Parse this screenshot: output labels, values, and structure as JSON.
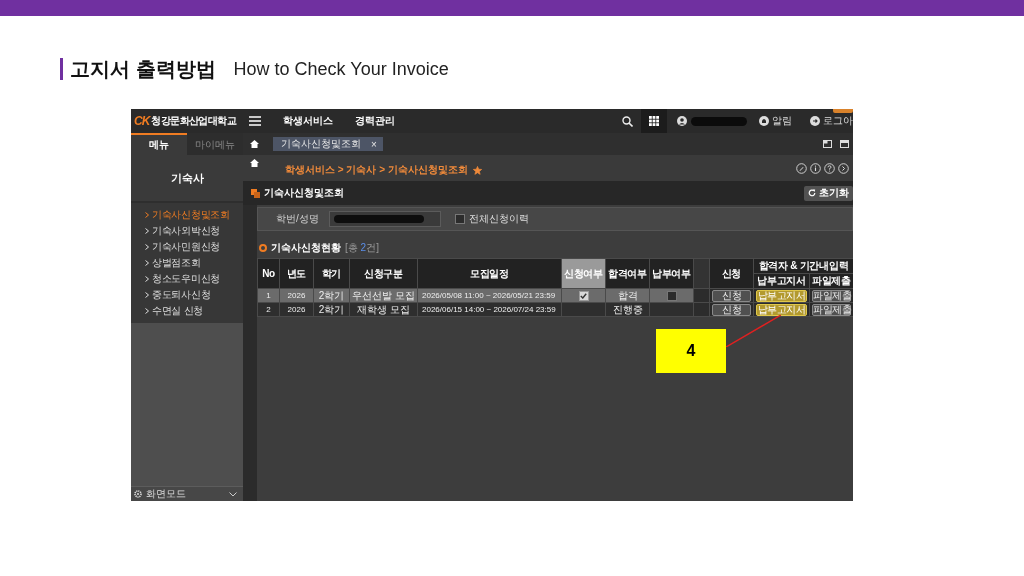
{
  "slide": {
    "title": "고지서 출력방법",
    "subtitle": "How to Check Your Invoice"
  },
  "header": {
    "logo_mark": "CK",
    "school_name": "청강문화산업대학교",
    "nav": [
      "학생서비스",
      "경력관리"
    ],
    "notification": "알림",
    "logout": "로그아"
  },
  "sidebar": {
    "tabs": [
      {
        "label": "메뉴",
        "selected": true
      },
      {
        "label": "마이메뉴",
        "selected": false
      }
    ],
    "title": "기숙사",
    "items": [
      {
        "label": "기숙사신청및조회",
        "selected": true
      },
      {
        "label": "기숙사외박신청",
        "selected": false
      },
      {
        "label": "기숙사민원신청",
        "selected": false
      },
      {
        "label": "상벌점조회",
        "selected": false
      },
      {
        "label": "청소도우미신청",
        "selected": false
      },
      {
        "label": "중도퇴사신청",
        "selected": false
      },
      {
        "label": "수면실 신청",
        "selected": false
      }
    ],
    "footer": "화면모드"
  },
  "open_tabs": [
    {
      "label": "기숙사신청및조회",
      "close": "×"
    }
  ],
  "breadcrumb": {
    "path": "학생서비스 > 기숙사 > 기숙사신청및조회",
    "favorite": true
  },
  "page": {
    "title": "기숙사신청및조회",
    "reset_button": "초기화"
  },
  "search": {
    "label": "학번/성명",
    "all_history": {
      "label": "전체신청이력",
      "checked": false
    }
  },
  "status": {
    "title": "기숙사신청현황",
    "count": {
      "before": "[총 ",
      "number": "2",
      "after": "건]"
    }
  },
  "table": {
    "columns": [
      {
        "label": "No",
        "highlighted": false
      },
      {
        "label": "년도",
        "highlighted": false
      },
      {
        "label": "학기",
        "highlighted": false
      },
      {
        "label": "신청구분",
        "highlighted": false
      },
      {
        "label": "모집일정",
        "highlighted": false
      },
      {
        "label": "신청여부",
        "highlighted": true
      },
      {
        "label": "합격여부",
        "highlighted": false
      },
      {
        "label": "납부여부",
        "highlighted": false
      }
    ],
    "action_header": "신청",
    "group_header": {
      "label": "합격자 & 기간내입력",
      "sub_columns": [
        "납부고지서",
        "파일제출"
      ]
    },
    "rows": [
      {
        "no": "1",
        "year": "2026",
        "term": "2학기",
        "type": "우선선발 모집",
        "period": "2026/05/08 11:00 ~ 2026/05/21 23:59",
        "applied": true,
        "result": "합격",
        "paid": false,
        "apply": "신청",
        "invoice": {
          "label": "납부고지서",
          "highlighted": true
        },
        "file": "파일제출",
        "selected": true
      },
      {
        "no": "2",
        "year": "2026",
        "term": "2학기",
        "type": "재학생 모집",
        "period": "2026/06/15 14:00 ~ 2026/07/24 23:59",
        "result": "진행중",
        "apply": "신청",
        "invoice": {
          "label": "납부고지서",
          "highlighted": true
        },
        "file": "파일제출",
        "selected": false
      }
    ]
  },
  "callout": {
    "label": "4"
  }
}
